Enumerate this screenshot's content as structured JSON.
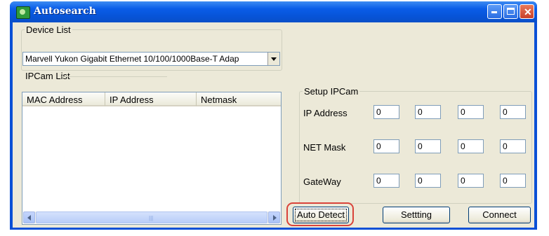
{
  "window": {
    "title": "Autosearch"
  },
  "device_list": {
    "legend": "Device List",
    "selected": "Marvell Yukon Gigabit Ethernet 10/100/1000Base-T Adap"
  },
  "ipcam_list": {
    "legend": "IPCam List",
    "columns": [
      "MAC Address",
      "IP Address",
      "Netmask"
    ]
  },
  "setup": {
    "legend": "Setup IPCam",
    "ip_label": "IP Address",
    "mask_label": "NET Mask",
    "gateway_label": "GateWay",
    "ip": [
      "0",
      "0",
      "0",
      "0"
    ],
    "mask": [
      "0",
      "0",
      "0",
      "0"
    ],
    "gateway": [
      "0",
      "0",
      "0",
      "0"
    ]
  },
  "buttons": {
    "auto_detect": "Auto Detect",
    "setting": "Settting",
    "connect": "Connect"
  },
  "colors": {
    "highlight_ring": "#d9433a",
    "titlebar": "#0754d8"
  }
}
